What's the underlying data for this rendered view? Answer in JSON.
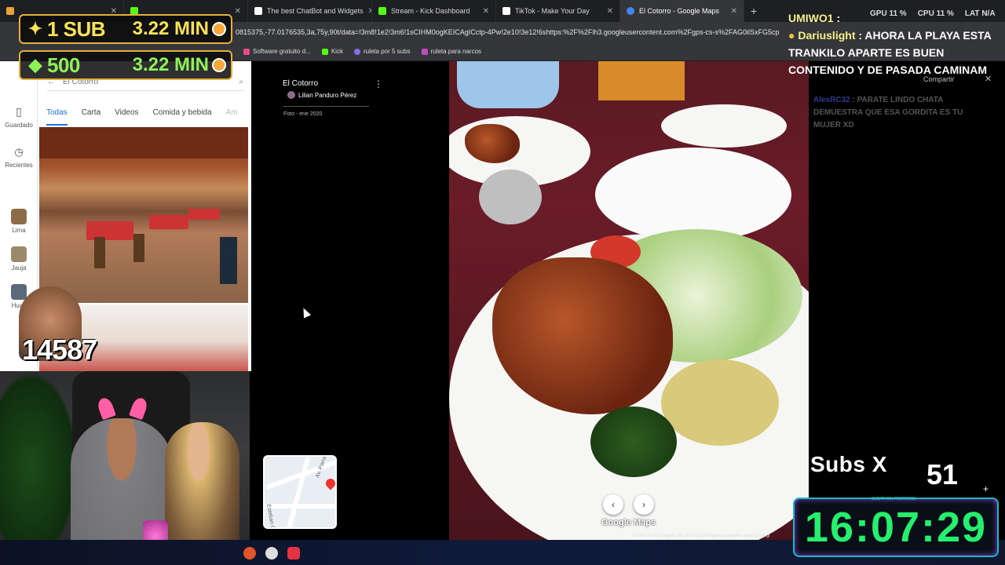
{
  "browser": {
    "tabs": [
      {
        "label": "",
        "color": "#e8a33a",
        "active": false
      },
      {
        "label": "",
        "color": "#53fc18",
        "active": false
      },
      {
        "label": "The best ChatBot and Widgets",
        "color": "#ffffff",
        "active": false
      },
      {
        "label": "Stream - Kick Dashboard",
        "color": "#53fc18",
        "active": false
      },
      {
        "label": "TikTok - Make Your Day",
        "color": "#ffffff",
        "active": false
      },
      {
        "label": "El Cotorro - Google Maps",
        "color": "#4285f4",
        "active": true
      }
    ],
    "new_tab": "+",
    "url": "0815375,-77.0176535,3a,75y,90t/data=!3m8!1e2!3m6!1sCIHM0ogKEICAgICctp-4Pw!2e10!3e12!6shttps:%2F%2Flh3.googleusercontent.com%2Fgps-cs-s%2FAG0ilSxFG5cp",
    "bookmarks": [
      {
        "label": "Software gratuito d...",
        "color": "#e94b8a"
      },
      {
        "label": "Kick",
        "color": "#53fc18"
      },
      {
        "label": "ruleta por 5 subs",
        "color": "#8a6be8"
      },
      {
        "label": "ruleta para narcos",
        "color": "#c04abf"
      }
    ]
  },
  "maps": {
    "search_value": "El Cotorro",
    "rail": [
      {
        "label": "Guardado",
        "icon": "bookmark-icon"
      },
      {
        "label": "Recientes",
        "icon": "history-icon"
      },
      {
        "label": "Lima",
        "icon": "place-thumb"
      },
      {
        "label": "Jauja",
        "icon": "place-thumb"
      },
      {
        "label": "Huas",
        "icon": "place-thumb"
      }
    ],
    "categories": [
      "Todas",
      "Carta",
      "Videos",
      "Comida y bebida",
      "Am"
    ],
    "viewer": {
      "place_name": "El Cotorro",
      "author": "Lilian Panduro Pérez",
      "date": "Foto - ene 2020",
      "minimap_streets": [
        "Av. Parra",
        "Esteban C"
      ],
      "watermark": "Google Maps",
      "footer": "Fecha de la imagen: dic 2019     Las imágenes pueden estar protegi"
    },
    "share_label": "Compartir"
  },
  "stream": {
    "sub_goal": {
      "label": "1 SUB",
      "time": "3.22 MIN"
    },
    "kick_goal": {
      "label": "500",
      "time": "3.22 MIN"
    },
    "face_counter": "14587",
    "perf": {
      "gpu": "GPU 11 %",
      "cpu": "CPU 11 %",
      "lat": "LAT N/A"
    },
    "chat": [
      {
        "user": "UMIWO1",
        "text": ""
      },
      {
        "user": "Dariuslight",
        "text": "AHORA LA PLAYA ESTA TRANKILO APARTE ES BUEN CONTENIDO Y DE PASADA CAMINAM"
      }
    ],
    "chat_dim": {
      "user": "AlexRC32",
      "text": "PARATE LINDO CHATA DEMUESTRA QUE ESA GORDITA ES TU MUJER XD"
    },
    "subs_label": "Subs X",
    "subs_count": "51",
    "timer_title": "SUBATHON PROTOCOL",
    "timer": "16:07:29",
    "colors": {
      "timer_text": "#26ee6e",
      "goal_gold": "#f7e25a",
      "goal_green": "#8ff05a"
    }
  }
}
